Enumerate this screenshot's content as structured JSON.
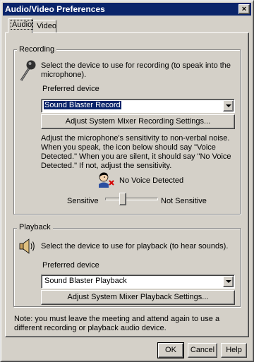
{
  "window": {
    "title": "Audio/Video Preferences",
    "close_glyph": "×"
  },
  "tabs": [
    {
      "label": "Audio"
    },
    {
      "label": "Video"
    }
  ],
  "recording": {
    "legend": "Recording",
    "description": "Select the device to use for recording (to speak into the microphone).",
    "preferred_label": "Preferred device",
    "device_value": "Sound Blaster Record",
    "mixer_button": "Adjust System Mixer Recording Settings...",
    "sensitivity_text": "Adjust the microphone's sensitivity to non-verbal noise. When you speak, the icon below should say \"Voice Detected.\" When you are silent, it should say \"No Voice Detected.\" If not, adjust the sensitivity.",
    "voice_status": "No Voice Detected",
    "slider_min_label": "Sensitive",
    "slider_max_label": "Not Sensitive",
    "slider_value_fraction": 0.3
  },
  "playback": {
    "legend": "Playback",
    "description": "Select the device to use for playback (to hear sounds).",
    "preferred_label": "Preferred device",
    "device_value": "Sound Blaster Playback",
    "mixer_button": "Adjust System Mixer Playback Settings..."
  },
  "note": "Note: you must leave the meeting and attend again to use a different recording or playback audio device.",
  "buttons": {
    "ok": "OK",
    "cancel": "Cancel",
    "help": "Help"
  },
  "icons": {
    "microphone": "microphone-icon",
    "voice_status": "person-no-voice-icon",
    "speaker": "speaker-icon"
  }
}
